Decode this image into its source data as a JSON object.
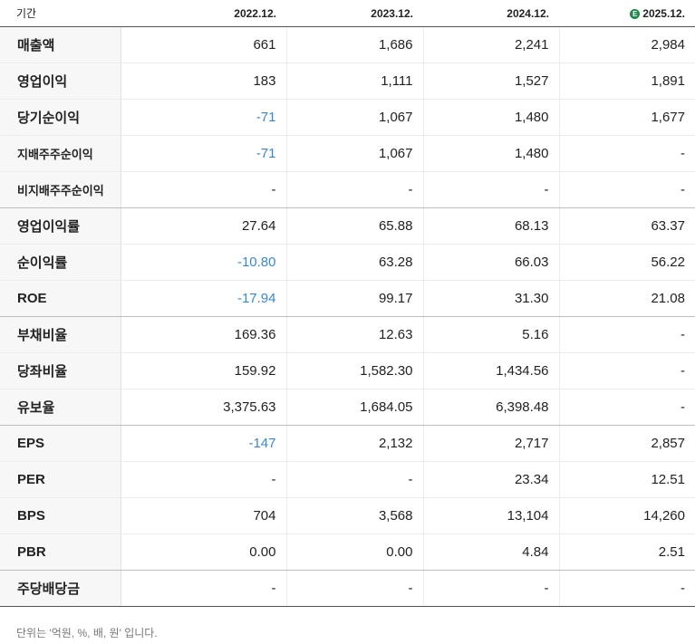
{
  "header": {
    "period_label": "기간",
    "columns": [
      "2022.12.",
      "2023.12.",
      "2024.12.",
      "2025.12."
    ],
    "estimate_icon": "estimate-icon",
    "estimate_glyph": "E"
  },
  "rows": [
    {
      "label": "매출액",
      "values": [
        "661",
        "1,686",
        "2,241",
        "2,984"
      ]
    },
    {
      "label": "영업이익",
      "values": [
        "183",
        "1,111",
        "1,527",
        "1,891"
      ]
    },
    {
      "label": "당기순이익",
      "values": [
        "-71",
        "1,067",
        "1,480",
        "1,677"
      ]
    },
    {
      "label": "지배주주순이익",
      "values": [
        "-71",
        "1,067",
        "1,480",
        "-"
      ]
    },
    {
      "label": "비지배주주순이익",
      "values": [
        "-",
        "-",
        "-",
        "-"
      ]
    },
    {
      "label": "영업이익률",
      "values": [
        "27.64",
        "65.88",
        "68.13",
        "63.37"
      ]
    },
    {
      "label": "순이익률",
      "values": [
        "-10.80",
        "63.28",
        "66.03",
        "56.22"
      ]
    },
    {
      "label": "ROE",
      "values": [
        "-17.94",
        "99.17",
        "31.30",
        "21.08"
      ]
    },
    {
      "label": "부채비율",
      "values": [
        "169.36",
        "12.63",
        "5.16",
        "-"
      ]
    },
    {
      "label": "당좌비율",
      "values": [
        "159.92",
        "1,582.30",
        "1,434.56",
        "-"
      ]
    },
    {
      "label": "유보율",
      "values": [
        "3,375.63",
        "1,684.05",
        "6,398.48",
        "-"
      ]
    },
    {
      "label": "EPS",
      "values": [
        "-147",
        "2,132",
        "2,717",
        "2,857"
      ]
    },
    {
      "label": "PER",
      "values": [
        "-",
        "-",
        "23.34",
        "12.51"
      ]
    },
    {
      "label": "BPS",
      "values": [
        "704",
        "3,568",
        "13,104",
        "14,260"
      ]
    },
    {
      "label": "PBR",
      "values": [
        "0.00",
        "0.00",
        "4.84",
        "2.51"
      ]
    },
    {
      "label": "주당배당금",
      "values": [
        "-",
        "-",
        "-",
        "-"
      ]
    }
  ],
  "footnote": "단위는 '억원, %, 배, 원' 입니다.",
  "colors": {
    "negative": "#3a86d6",
    "estimate_badge": "#1f8a4c"
  }
}
